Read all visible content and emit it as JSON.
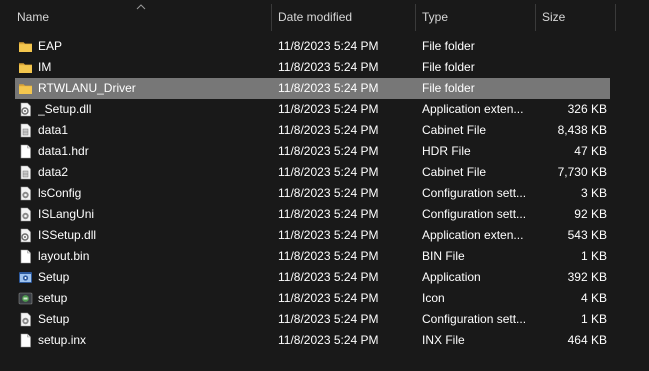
{
  "columns": {
    "name": "Name",
    "date": "Date modified",
    "type": "Type",
    "size": "Size"
  },
  "files": [
    {
      "name": "EAP",
      "date": "11/8/2023 5:24 PM",
      "type": "File folder",
      "size": "",
      "icon": "folder-icon",
      "selected": false
    },
    {
      "name": "IM",
      "date": "11/8/2023 5:24 PM",
      "type": "File folder",
      "size": "",
      "icon": "folder-icon",
      "selected": false
    },
    {
      "name": "RTWLANU_Driver",
      "date": "11/8/2023 5:24 PM",
      "type": "File folder",
      "size": "",
      "icon": "folder-icon",
      "selected": true
    },
    {
      "name": "_Setup.dll",
      "date": "11/8/2023 5:24 PM",
      "type": "Application exten...",
      "size": "326 KB",
      "icon": "dll-gear-icon",
      "selected": false
    },
    {
      "name": "data1",
      "date": "11/8/2023 5:24 PM",
      "type": "Cabinet File",
      "size": "8,438 KB",
      "icon": "cabinet-file-icon",
      "selected": false
    },
    {
      "name": "data1.hdr",
      "date": "11/8/2023 5:24 PM",
      "type": "HDR File",
      "size": "47 KB",
      "icon": "blank-file-icon",
      "selected": false
    },
    {
      "name": "data2",
      "date": "11/8/2023 5:24 PM",
      "type": "Cabinet File",
      "size": "7,730 KB",
      "icon": "cabinet-file-icon",
      "selected": false
    },
    {
      "name": "lsConfig",
      "date": "11/8/2023 5:24 PM",
      "type": "Configuration sett...",
      "size": "3 KB",
      "icon": "config-gear-icon",
      "selected": false
    },
    {
      "name": "ISLangUni",
      "date": "11/8/2023 5:24 PM",
      "type": "Configuration sett...",
      "size": "92 KB",
      "icon": "config-gear-icon",
      "selected": false
    },
    {
      "name": "ISSetup.dll",
      "date": "11/8/2023 5:24 PM",
      "type": "Application exten...",
      "size": "543 KB",
      "icon": "dll-gear-icon",
      "selected": false
    },
    {
      "name": "layout.bin",
      "date": "11/8/2023 5:24 PM",
      "type": "BIN File",
      "size": "1 KB",
      "icon": "blank-file-icon",
      "selected": false
    },
    {
      "name": "Setup",
      "date": "11/8/2023 5:24 PM",
      "type": "Application",
      "size": "392 KB",
      "icon": "setup-app-icon",
      "selected": false
    },
    {
      "name": "setup",
      "date": "11/8/2023 5:24 PM",
      "type": "Icon",
      "size": "4 KB",
      "icon": "setup-image-icon",
      "selected": false
    },
    {
      "name": "Setup",
      "date": "11/8/2023 5:24 PM",
      "type": "Configuration sett...",
      "size": "1 KB",
      "icon": "config-gear-icon",
      "selected": false
    },
    {
      "name": "setup.inx",
      "date": "11/8/2023 5:24 PM",
      "type": "INX File",
      "size": "464 KB",
      "icon": "blank-file-icon",
      "selected": false
    }
  ],
  "colors": {
    "background": "#191919",
    "selected_row": "#777777",
    "folder": "#f3c64e",
    "text": "#ffffff"
  }
}
